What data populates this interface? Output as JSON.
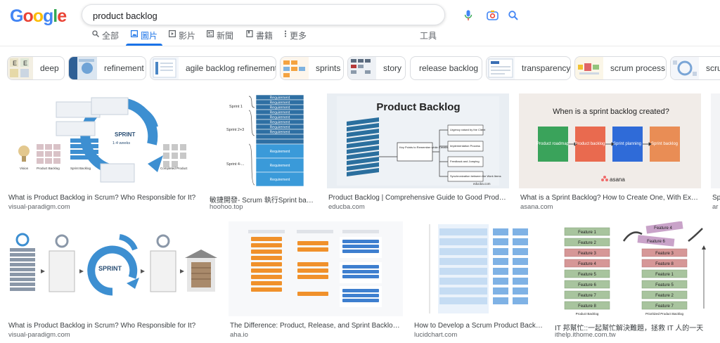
{
  "logo": "Google",
  "search": {
    "query": "product backlog"
  },
  "tabs": [
    {
      "label": "全部",
      "icon": "search-icon"
    },
    {
      "label": "圖片",
      "icon": "image-icon",
      "active": true
    },
    {
      "label": "影片",
      "icon": "play-icon"
    },
    {
      "label": "新聞",
      "icon": "news-icon"
    },
    {
      "label": "書籍",
      "icon": "book-icon"
    },
    {
      "label": "更多",
      "icon": "more-vert-icon"
    }
  ],
  "tools_label": "工具",
  "chips": [
    {
      "label": "deep"
    },
    {
      "label": "refinement"
    },
    {
      "label": "agile backlog refinement"
    },
    {
      "label": "sprints"
    },
    {
      "label": "story"
    },
    {
      "label": "release backlog"
    },
    {
      "label": "transparency"
    },
    {
      "label": "scrum process"
    },
    {
      "label": "scrum"
    }
  ],
  "results_row1": [
    {
      "title": "What is Product Backlog in Scrum? Who Responsible for It?",
      "source": "visual-paradigm.com"
    },
    {
      "title": "敏捷開發- Scrum 執行Sprint backl...",
      "source": "hoohoo.top"
    },
    {
      "title": "Product Backlog | Comprehensive Guide to Good Product B...",
      "source": "educba.com"
    },
    {
      "title": "What is a Sprint Backlog? How to Create One, With Example...",
      "source": "asana.com"
    },
    {
      "title": "Sp",
      "source": "ar"
    }
  ],
  "results_row2": [
    {
      "title": "What is Product Backlog in Scrum? Who Responsible for It?",
      "source": "visual-paradigm.com"
    },
    {
      "title": "The Difference: Product, Release, and Sprint Backlogs | ...",
      "source": "aha.io"
    },
    {
      "title": "How to Develop a Scrum Product Backlog...",
      "source": "lucidchart.com"
    },
    {
      "title": "IT 邦幫忙::一起幫忙解決難題，拯救 IT 人的一天",
      "source": "ithelp.ithome.com.tw"
    }
  ],
  "image_text": {
    "vp_sprint": "SPRINT",
    "vp_weeks": "1-4 weeks",
    "vp_labels": [
      "Vision",
      "Product Backlog",
      "Sprint Backlog",
      "Completed Product"
    ],
    "hh_sprints": [
      "Sprint 1",
      "Sprint 2+3",
      "Sprint 4-..."
    ],
    "hh_req": "Requirement",
    "ed_title": "Product Backlog",
    "ed_center": "Key Points to Remember while Creating a Product Backlog",
    "ed_points": [
      "Urgency raised by the Client",
      "Implementation Process",
      "Feedback and Jumping",
      "Synchronization between the Work Items"
    ],
    "ed_brand": "educba.com",
    "as_title": "When is a sprint backlog created?",
    "as_boxes": [
      "Product roadmap",
      "Product backlog",
      "Sprint planning",
      "Sprint backlog"
    ],
    "as_brand": "asana",
    "vp2_sprint": "SPRINT",
    "ith_features_left": [
      "Feature 1",
      "Feature 2",
      "Feature 3",
      "Feature 4",
      "Feature 5",
      "Feature 6",
      "Feature 7",
      "Feature 8"
    ],
    "ith_features_right": [
      "Feature 3",
      "Feature 8",
      "Feature 1",
      "Feature 5",
      "Feature 2",
      "Feature 7"
    ],
    "ith_top": [
      "Feature 4",
      "Feature 6"
    ],
    "ith_captions": [
      "Product Backlog",
      "Prioritized Product Backlog"
    ]
  },
  "colors": {
    "accent": "#1a73e8",
    "asana_green": "#3aa35b",
    "asana_red": "#e96a4f",
    "asana_blue": "#2f6bd8",
    "asana_orange": "#e98d55"
  }
}
